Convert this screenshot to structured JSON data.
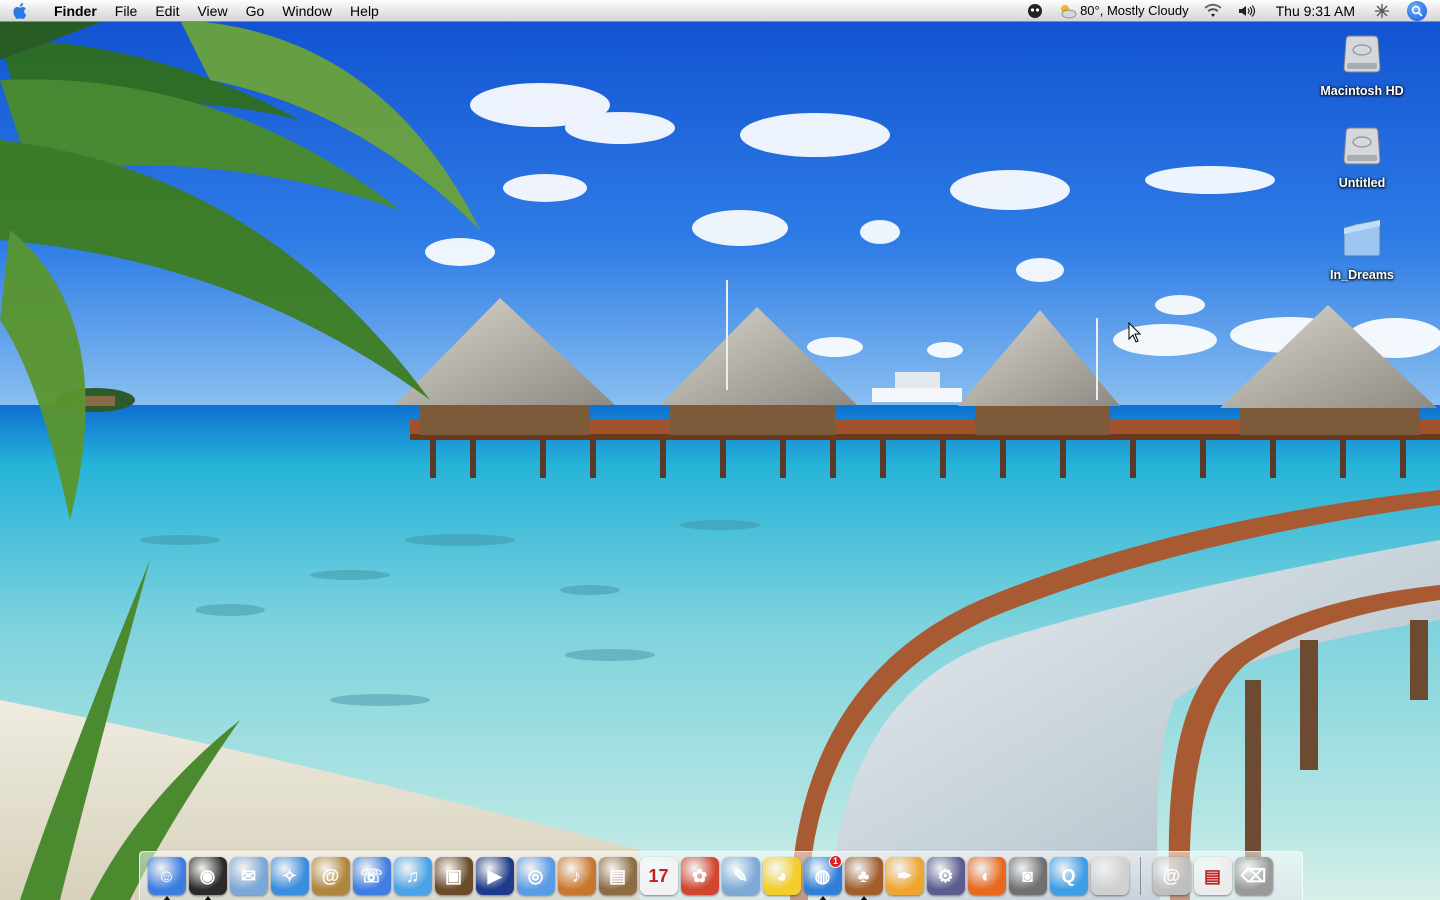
{
  "menubar": {
    "app_name": "Finder",
    "menus": [
      "File",
      "Edit",
      "View",
      "Go",
      "Window",
      "Help"
    ],
    "weather": "80°, Mostly Cloudy",
    "clock": "Thu 9:31 AM"
  },
  "desktop": {
    "icons": [
      {
        "label": "Macintosh HD",
        "icon": "hard-drive-icon"
      },
      {
        "label": "Untitled",
        "icon": "hard-drive-icon"
      },
      {
        "label": "In_Dreams",
        "icon": "folder-icon"
      }
    ]
  },
  "dock": {
    "apps": [
      {
        "name": "finder",
        "icon": "finder-icon",
        "color": "#3d7de0",
        "glyph": "☺",
        "running": true
      },
      {
        "name": "dashboard",
        "icon": "dashboard-icon",
        "color": "#2a2a2a",
        "glyph": "◉",
        "running": true
      },
      {
        "name": "mail",
        "icon": "mail-icon",
        "color": "#7aa7d8",
        "glyph": "✉",
        "running": false
      },
      {
        "name": "safari",
        "icon": "safari-compass-icon",
        "color": "#3b8de0",
        "glyph": "✧",
        "running": false
      },
      {
        "name": "address-book",
        "icon": "address-book-icon",
        "color": "#b0853e",
        "glyph": "@",
        "running": false
      },
      {
        "name": "ichat",
        "icon": "ichat-icon",
        "color": "#3f7fe2",
        "glyph": "☏",
        "running": false
      },
      {
        "name": "itunes",
        "icon": "itunes-icon",
        "color": "#4aa3e8",
        "glyph": "♫",
        "running": false
      },
      {
        "name": "iphoto",
        "icon": "iphoto-icon",
        "color": "#6b4b2a",
        "glyph": "▣",
        "running": false
      },
      {
        "name": "imovie",
        "icon": "imovie-icon",
        "color": "#1e3a8a",
        "glyph": "▶",
        "running": false
      },
      {
        "name": "idvd",
        "icon": "idvd-icon",
        "color": "#5a9be6",
        "glyph": "◎",
        "running": false
      },
      {
        "name": "garageband",
        "icon": "garageband-icon",
        "color": "#c9772e",
        "glyph": "♪",
        "running": false
      },
      {
        "name": "iweb",
        "icon": "iweb-icon",
        "color": "#8d6b43",
        "glyph": "▤",
        "running": false
      },
      {
        "name": "ical",
        "icon": "ical-calendar-icon",
        "color": "#f2f2f2",
        "glyph": "17",
        "running": false
      },
      {
        "name": "bug-app",
        "icon": "ladybug-icon",
        "color": "#d2452f",
        "glyph": "✿",
        "running": false
      },
      {
        "name": "preview",
        "icon": "preview-icon",
        "color": "#7ea9d6",
        "glyph": "✎",
        "running": false
      },
      {
        "name": "cyberduck",
        "icon": "rubber-duck-icon",
        "color": "#f4cd2a",
        "glyph": "◕",
        "running": false
      },
      {
        "name": "network-globe",
        "icon": "globe-icon",
        "color": "#2f7ed8",
        "glyph": "◍",
        "running": true,
        "badge": "1"
      },
      {
        "name": "adium",
        "icon": "duck-figure-icon",
        "color": "#a25e2a",
        "glyph": "♣",
        "running": true
      },
      {
        "name": "pages",
        "icon": "pages-icon",
        "color": "#f0a52e",
        "glyph": "✒",
        "running": false
      },
      {
        "name": "automator",
        "icon": "automator-icon",
        "color": "#5c5c8f",
        "glyph": "⚙",
        "running": false
      },
      {
        "name": "firefox",
        "icon": "firefox-icon",
        "color": "#e8681c",
        "glyph": "◐",
        "running": false
      },
      {
        "name": "image-capture",
        "icon": "camera-icon",
        "color": "#707070",
        "glyph": "◙",
        "running": false
      },
      {
        "name": "quicktime",
        "icon": "quicktime-icon",
        "color": "#3e9ee6",
        "glyph": "Q",
        "running": false
      },
      {
        "name": "system-prefs",
        "icon": "apple-prefs-icon",
        "color": "#d0d0d0",
        "glyph": "",
        "running": false
      }
    ],
    "documents": [
      {
        "name": "mail-at-stack",
        "icon": "at-sign-stack-icon",
        "color": "#bfbfbf",
        "glyph": "@"
      },
      {
        "name": "downloads-stack",
        "icon": "document-stack-icon",
        "color": "#ececec",
        "glyph": "▤"
      },
      {
        "name": "trash",
        "icon": "trash-icon",
        "color": "#9a9a9a",
        "glyph": "⌫"
      }
    ]
  }
}
